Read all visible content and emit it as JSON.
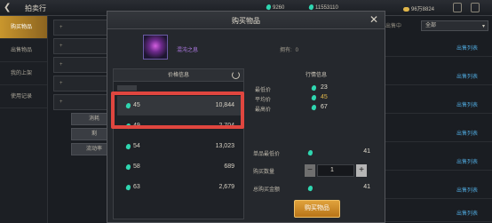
{
  "topbar": {
    "title": "拍卖行",
    "currency1": "9260",
    "currency2": "11553110",
    "currency3": "96万8824"
  },
  "sidebar": {
    "items": [
      {
        "label": "购买物品"
      },
      {
        "label": "出售物品"
      },
      {
        "label": "我的上架"
      },
      {
        "label": "使用记录"
      }
    ]
  },
  "middle": {
    "rows": [
      "+",
      "+",
      "+",
      "+",
      "+"
    ],
    "buttons": [
      "消耗",
      "剩",
      "流动率"
    ]
  },
  "right_bg": {
    "tab": "出售中",
    "select_value": "全部",
    "link_label": "出售列表"
  },
  "modal": {
    "title": "购买物品",
    "item_name": "混沌之息",
    "owned_label": "拥有:",
    "owned_value": "0",
    "price_panel": {
      "title": "价格信息",
      "rows": [
        {
          "price": "45",
          "qty": "10,844"
        },
        {
          "price": "49",
          "qty": "2,704"
        },
        {
          "price": "54",
          "qty": "13,023"
        },
        {
          "price": "58",
          "qty": "689"
        },
        {
          "price": "63",
          "qty": "2,679"
        }
      ]
    },
    "market_panel": {
      "title": "行情信息",
      "min_label": "最低价",
      "min_value": "23",
      "avg_label": "平均价",
      "avg_value": "45",
      "max_label": "最高价",
      "max_value": "67"
    },
    "buy_panel": {
      "unit_price_label": "单品最低价",
      "unit_price_value": "41",
      "qty_label": "购买数量",
      "qty_value": "1",
      "total_label": "总购买金额",
      "total_value": "41",
      "buy_label": "购买物品"
    }
  },
  "colors": {
    "accent": "#e0a23c",
    "highlight": "#e0463f",
    "gem": "#2fd6b0",
    "item_name": "#b07ae6"
  }
}
